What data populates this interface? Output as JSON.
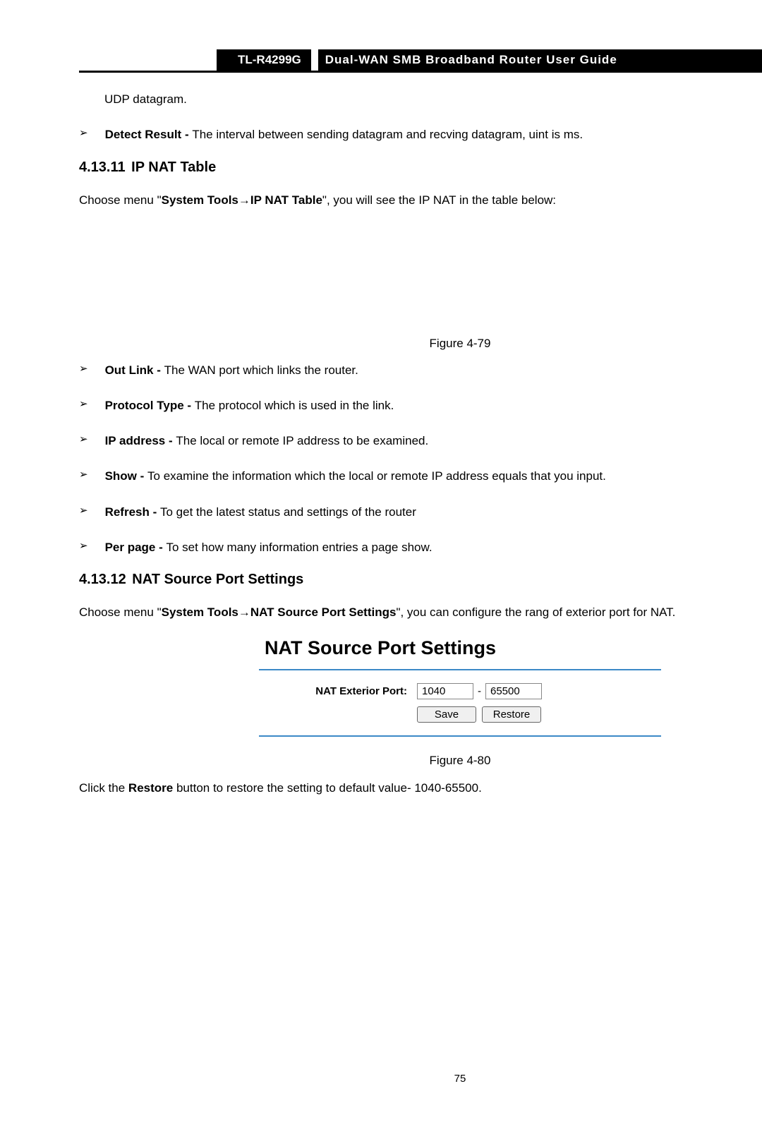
{
  "header": {
    "model": "TL-R4299G",
    "title": "Dual-WAN SMB Broadband Router User Guide"
  },
  "intro_fragment": "UDP datagram.",
  "bullets_top": {
    "detect_result": {
      "label": "Detect Result - ",
      "text": "The interval between sending datagram and recving datagram, uint is ms."
    }
  },
  "section1": {
    "number": "4.13.11",
    "title": " IP NAT Table",
    "para_prefix": "Choose menu \"",
    "para_bold1": "System Tools",
    "para_arrow": "→",
    "para_bold2": "IP NAT Table",
    "para_suffix": "\", you will see the IP NAT in the table below:"
  },
  "figure79": "Figure 4-79",
  "bullets_mid": {
    "out_link": {
      "label": "Out Link - ",
      "text": "The WAN port which links the router."
    },
    "protocol_type": {
      "label": "Protocol Type - ",
      "text": "The protocol which is used in the link."
    },
    "ip_address": {
      "label": "IP address - ",
      "text": "The local or remote IP address to be examined."
    },
    "show": {
      "label": "Show - ",
      "text": "To examine the information which the local or remote IP address equals that you input."
    },
    "refresh": {
      "label": "Refresh - ",
      "text": "To get the latest status and settings of the router"
    },
    "per_page": {
      "label": "Per page - ",
      "text": "To set how many information entries a page show."
    }
  },
  "section2": {
    "number": "4.13.12",
    "title": " NAT Source Port Settings",
    "para_prefix": "Choose menu \"",
    "para_bold1": "System Tools",
    "para_arrow": "→",
    "para_bold2": "NAT Source Port Settings",
    "para_suffix": "\", you can configure the rang of exterior port for NAT."
  },
  "nat_panel": {
    "title": "NAT Source Port Settings",
    "label": "NAT Exterior Port:",
    "port_start": "1040",
    "port_end": "65500",
    "save": "Save",
    "restore": "Restore"
  },
  "figure80": "Figure 4-80",
  "restore_para_prefix": "Click the ",
  "restore_para_bold": "Restore",
  "restore_para_suffix": " button to restore the setting to default value- 1040-65500.",
  "page_number": "75",
  "glyph": {
    "bullet": "➢"
  }
}
